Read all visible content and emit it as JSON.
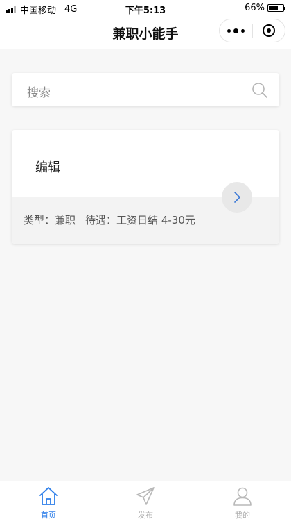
{
  "status_bar": {
    "carrier": "中国移动",
    "network": "4G",
    "time": "下午5:13",
    "battery": "66%",
    "battery_level": 0.66
  },
  "nav": {
    "title": "兼职小能手"
  },
  "search": {
    "placeholder": "搜索"
  },
  "job_list": [
    {
      "title": "编辑",
      "type_label": "类型：",
      "type_value": "兼职",
      "pay_label": "待遇：",
      "pay_value": "工资日结 4-30元"
    }
  ],
  "tabs": [
    {
      "label": "首页",
      "icon": "home-icon",
      "active": true
    },
    {
      "label": "发布",
      "icon": "paper-plane-icon",
      "active": false
    },
    {
      "label": "我的",
      "icon": "user-icon",
      "active": false
    }
  ],
  "colors": {
    "accent": "#2b7de9",
    "inactive": "#b0b0b0",
    "background": "#f7f7f7"
  }
}
